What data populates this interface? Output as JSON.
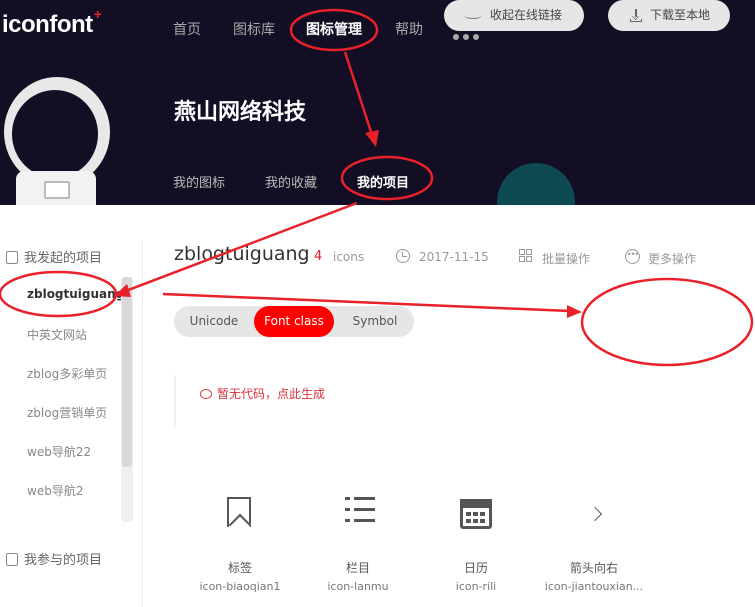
{
  "header": {
    "logo_text": "iconfont",
    "logo_plus": "+",
    "nav": [
      {
        "label": "首页"
      },
      {
        "label": "图标库"
      },
      {
        "label": "图标管理"
      },
      {
        "label": "帮助"
      }
    ],
    "more_icon": "ellipsis-icon"
  },
  "team": {
    "title": "燕山网络科技",
    "tabs": [
      {
        "label": "我的图标"
      },
      {
        "label": "我的收藏"
      },
      {
        "label": "我的项目"
      }
    ]
  },
  "sidebar": {
    "initiated_heading": "我发起的项目",
    "projects": [
      {
        "label": "zblogtuiguang"
      },
      {
        "label": "中英文网站"
      },
      {
        "label": "zblog多彩单页"
      },
      {
        "label": "zblog营销单页"
      },
      {
        "label": "web导航22"
      },
      {
        "label": "web导航2"
      }
    ],
    "joined_heading": "我参与的项目"
  },
  "project": {
    "name": "zblogtuiguang",
    "icon_count": "4",
    "icon_unit": "icons",
    "date": "2017-11-15",
    "batch_label": "批量操作",
    "more_label": "更多操作"
  },
  "code_tabs": [
    {
      "label": "Unicode"
    },
    {
      "label": "Font class"
    },
    {
      "label": "Symbol"
    }
  ],
  "actions": {
    "collapse_label": "收起在线链接",
    "download_label": "下载至本地"
  },
  "code_area": {
    "message": "暂无代码，点此生成"
  },
  "icons": [
    {
      "name": "标签",
      "code": "icon-biaoqian1",
      "icon": "bookmark-icon"
    },
    {
      "name": "栏目",
      "code": "icon-lanmu",
      "icon": "list-icon"
    },
    {
      "name": "日历",
      "code": "icon-rili",
      "icon": "calendar-icon"
    },
    {
      "name": "箭头向右",
      "code": "icon-jiantouxian...",
      "icon": "arrow-right-icon"
    }
  ],
  "colors": {
    "header_bg": "#130e23",
    "accent": "#ff0000",
    "annotation": "#e8212b"
  }
}
